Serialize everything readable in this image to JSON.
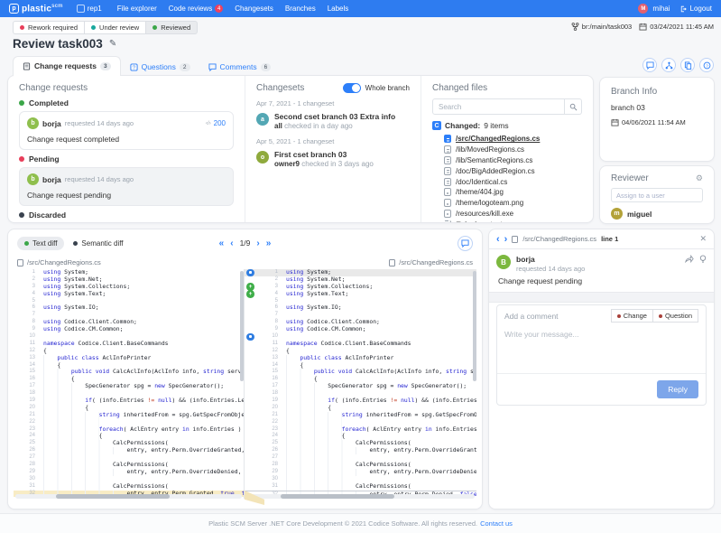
{
  "navbar": {
    "logo_text": "plastic",
    "logo_sup": "scm",
    "logo_glyph": "p",
    "repo": "rep1",
    "links": [
      {
        "label": "File explorer"
      },
      {
        "label": "Code reviews",
        "badge": "4"
      },
      {
        "label": "Changesets"
      },
      {
        "label": "Branches"
      },
      {
        "label": "Labels"
      }
    ],
    "user_name": "mihai",
    "user_initial": "M",
    "logout_label": "Logout"
  },
  "status_row": {
    "chips": [
      {
        "label": "Rework required",
        "dot": "#e83e5a",
        "selected": false
      },
      {
        "label": "Under review",
        "dot": "#19a89d",
        "selected": false
      },
      {
        "label": "Reviewed",
        "dot": "#3ba648",
        "selected": true
      }
    ],
    "branch_ref": "br:/main/task003",
    "datetime": "03/24/2021 11:45 AM"
  },
  "page": {
    "title": "Review task003"
  },
  "tabs": [
    {
      "label": "Change requests",
      "count": "3",
      "active": true,
      "icon": "request"
    },
    {
      "label": "Questions",
      "count": "2",
      "active": false,
      "icon": "question"
    },
    {
      "label": "Comments",
      "count": "6",
      "active": false,
      "icon": "comment"
    }
  ],
  "change_requests": {
    "header": "Change requests",
    "groups": [
      {
        "label": "Completed",
        "dot": "#3ba648",
        "card": {
          "user": "borja",
          "user_initial": "b",
          "avatar_color": "#8fbf4d",
          "meta": "requested 14 days ago",
          "line_ref": "200",
          "text": "Change request completed",
          "selected": false
        }
      },
      {
        "label": "Pending",
        "dot": "#e83e5a",
        "card": {
          "user": "borja",
          "user_initial": "b",
          "avatar_color": "#8fbf4d",
          "meta": "requested 14 days ago",
          "line_ref": "",
          "text": "Change request pending",
          "selected": true
        }
      },
      {
        "label": "Discarded",
        "dot": "#39424e",
        "card": null
      }
    ]
  },
  "changesets": {
    "header": "Changesets",
    "toggle_label": "Whole branch",
    "toggle_on": true,
    "groups": [
      {
        "date": "Apr 7, 2021 - 1 changeset",
        "title": "Second cset branch 03 Extra info",
        "author": "all",
        "meta": "checked in a day ago",
        "avatar_initial": "a",
        "avatar_color": "#53a7b4"
      },
      {
        "date": "Apr 5, 2021 - 1 changeset",
        "title": "First cset branch 03",
        "author": "owner9",
        "meta": "checked in 3 days ago",
        "avatar_initial": "o",
        "avatar_color": "#8faa3d"
      }
    ]
  },
  "changed_files": {
    "header": "Changed files",
    "search_placeholder": "Search",
    "category_badge": "C",
    "category_label": "Changed:",
    "category_count": "9 items",
    "files": [
      {
        "name": "/src/ChangedRegions.cs",
        "type": "cs",
        "selected": true
      },
      {
        "name": "/lib/MovedRegions.cs",
        "type": "cs",
        "selected": false
      },
      {
        "name": "/lib/SemanticRegions.cs",
        "type": "cs",
        "selected": false
      },
      {
        "name": "/doc/BigAddedRegion.cs",
        "type": "cs",
        "selected": false
      },
      {
        "name": "/doc/Identical.cs",
        "type": "cs",
        "selected": false
      },
      {
        "name": "/theme/404.jpg",
        "type": "media",
        "selected": false
      },
      {
        "name": "/theme/logoteam.png",
        "type": "media",
        "selected": false
      },
      {
        "name": "/resources/kill.exe",
        "type": "media",
        "selected": false
      },
      {
        "name": "/linked content",
        "type": "folder",
        "selected": false
      }
    ]
  },
  "branch_info": {
    "header": "Branch Info",
    "branch": "branch 03",
    "datetime": "04/06/2021 11:54 AM"
  },
  "reviewer": {
    "header": "Reviewer",
    "assign_placeholder": "Assign to a user",
    "user": "miguel",
    "user_initial": "m",
    "avatar_color": "#b3a238"
  },
  "diff": {
    "modes": [
      {
        "label": "Text diff",
        "dot": "#3ba648",
        "active": true
      },
      {
        "label": "Semantic diff",
        "dot": "#39424e",
        "active": false
      }
    ],
    "pager": "1/9",
    "file_left": "/src/ChangedRegions.cs",
    "file_right": "/src/ChangedRegions.cs",
    "lines_left": [
      "using System;",
      "using System.Net;",
      "using System.Collections;",
      "using System.Text;",
      "",
      "using System.IO;",
      "",
      "using Codice.Client.Common;",
      "using Codice.CM.Common;",
      "",
      "namespace Codice.Client.BaseCommands",
      "{",
      "    public class AclInfoPrinter",
      "    {",
      "        public void CalcAclInfo(AclInfo info, string server, WorkspaceInfo wk)",
      "        {",
      "            SpecGenerator spg = new SpecGenerator();",
      "",
      "            if( (info.Entries != null) && (info.Entries.Length > 0) )",
      "            {",
      "                string inheritedFrom = spg.GetSpecFromObjectInfo(info);",
      "",
      "                foreach( AclEntry entry in info.Entries )",
      "                {",
      "                    CalcPermissions(",
      "                        entry, entry.Perm.OverrideGranted, false, true);",
      "",
      "                    CalcPermissions(",
      "                        entry, entry.Perm.OverrideDenied, false, true);",
      "",
      "                    CalcPermissions(",
      "                        entry, entry.Perm.Granted, true, false);",
      ""
    ],
    "lines_right": [
      "using System;",
      "using System.Net;",
      "using System.Collections;",
      "using System.Text;",
      "",
      "using System.IO;",
      "",
      "using Codice.Client.Common;",
      "using Codice.CM.Common;",
      "",
      "namespace Codice.Client.BaseCommands",
      "{",
      "    public class AclInfoPrinter",
      "    {",
      "        public void CalcAclInfo(AclInfo info, string server, WorkspaceInfo wk)",
      "        {",
      "            SpecGenerator spg = new SpecGenerator();",
      "",
      "            if( (info.Entries != null) && (info.Entries.Length > 0) )",
      "            {",
      "                string inheritedFrom = spg.GetSpecFromObjectInfo(info);",
      "",
      "                foreach( AclEntry entry in info.Entries )",
      "                {",
      "                    CalcPermissions(",
      "                        entry, entry.Perm.OverrideGranted, false, true);",
      "",
      "                    CalcPermissions(",
      "                        entry, entry.Perm.OverrideDenied, false, true);",
      "",
      "                    CalcPermissions(",
      "                        entry, entry.Perm.Denied, false, true,",
      "                    }"
    ],
    "left_highlight_line": 32,
    "right_selected_line": 1,
    "right_region_lines": [
      32
    ],
    "right_markers": [
      {
        "line": 1,
        "kind": "comment"
      },
      {
        "line": 3,
        "kind": "add"
      },
      {
        "line": 4,
        "kind": "add"
      },
      {
        "line": 10,
        "kind": "comment"
      }
    ]
  },
  "comment_panel": {
    "file": "/src/ChangedRegions.cs",
    "line_label": "line 1",
    "user": "borja",
    "user_initial": "B",
    "meta": "requested 14 days ago",
    "text": "Change request pending",
    "form": {
      "label": "Add a comment",
      "options": [
        {
          "label": "Change",
          "dot": "#a8403a"
        },
        {
          "label": "Question",
          "dot": "#a8403a"
        }
      ],
      "placeholder": "Write your message...",
      "submit": "Reply"
    }
  },
  "footer": {
    "text": "Plastic SCM Server .NET Core Development © 2021 Codice Software. All rights reserved.",
    "link": "Contact us"
  }
}
